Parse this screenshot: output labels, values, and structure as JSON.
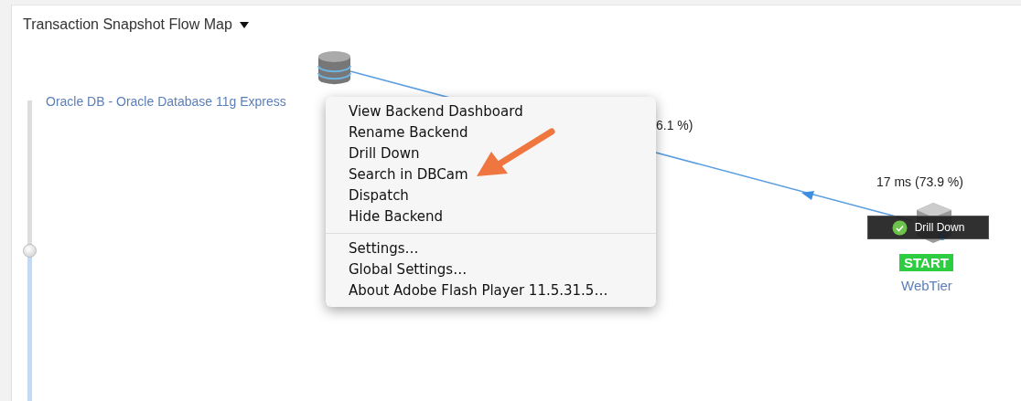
{
  "title": "Transaction Snapshot Flow Map",
  "zoom_slider": {
    "level": 0.5
  },
  "backend": {
    "label": "Oracle DB - Oracle Database 11g Express"
  },
  "edges": [
    {
      "label": "6.1 %)"
    },
    {
      "label": "17 ms (73.9 %)"
    }
  ],
  "tier": {
    "badge": "START",
    "name": "WebTier",
    "tooltip": "Drill Down"
  },
  "context_menu": {
    "groups": [
      [
        "View Backend Dashboard",
        "Rename Backend",
        "Drill Down",
        "Search in DBCam",
        "Dispatch",
        "Hide Backend"
      ],
      [
        "Settings…",
        "Global Settings…",
        "About Adobe Flash Player 11.5.31.5…"
      ]
    ]
  }
}
